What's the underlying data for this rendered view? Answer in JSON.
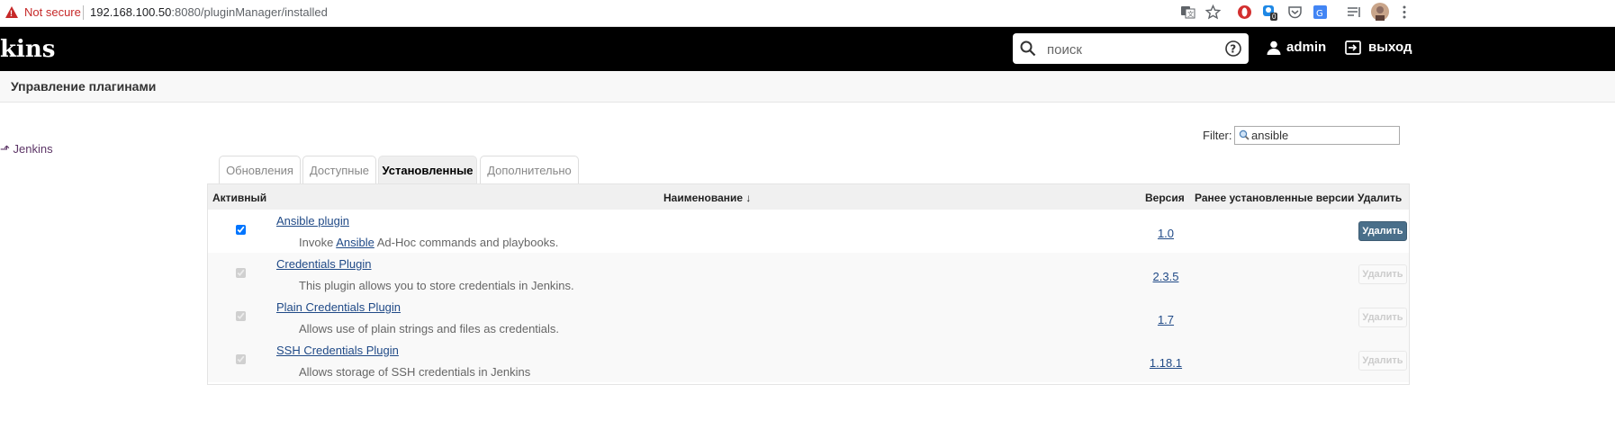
{
  "browser": {
    "security_label": "Not secure",
    "url_host": "192.168.100.50",
    "url_rest": ":8080/pluginManager/installed",
    "extension_badge": "0"
  },
  "header": {
    "logo_text": "kins",
    "search_placeholder": "поиск",
    "user_label": "admin",
    "logout_label": "выход"
  },
  "breadcrumb": {
    "title": "Управление плагинами"
  },
  "sidebar": {
    "back_link": "Jenkins"
  },
  "filter": {
    "label": "Filter:",
    "value": "ansible"
  },
  "tabs": [
    {
      "label": "Обновления",
      "active": false
    },
    {
      "label": "Доступные",
      "active": false
    },
    {
      "label": "Установленные",
      "active": true
    },
    {
      "label": "Дополнительно",
      "active": false
    }
  ],
  "table": {
    "headers": {
      "active": "Активный",
      "name": "Наименование ↓",
      "version": "Версия",
      "previous": "Ранее установленные версии",
      "uninstall": "Удалить"
    },
    "rows": [
      {
        "name": "Ansible plugin",
        "desc_pre": "Invoke ",
        "desc_link": "Ansible",
        "desc_post": " Ad-Hoc commands and playbooks.",
        "version": "1.0",
        "button": "Удалить",
        "enabled": true
      },
      {
        "name": "Credentials Plugin",
        "desc_pre": "This plugin allows you to store credentials in Jenkins.",
        "desc_link": "",
        "desc_post": "",
        "version": "2.3.5",
        "button": "Удалить",
        "enabled": false
      },
      {
        "name": "Plain Credentials Plugin",
        "desc_pre": "Allows use of plain strings and files as credentials.",
        "desc_link": "",
        "desc_post": "",
        "version": "1.7",
        "button": "Удалить",
        "enabled": false
      },
      {
        "name": "SSH Credentials Plugin",
        "desc_pre": "Allows storage of SSH credentials in Jenkins",
        "desc_link": "",
        "desc_post": "",
        "version": "1.18.1",
        "button": "Удалить",
        "enabled": false
      }
    ]
  }
}
